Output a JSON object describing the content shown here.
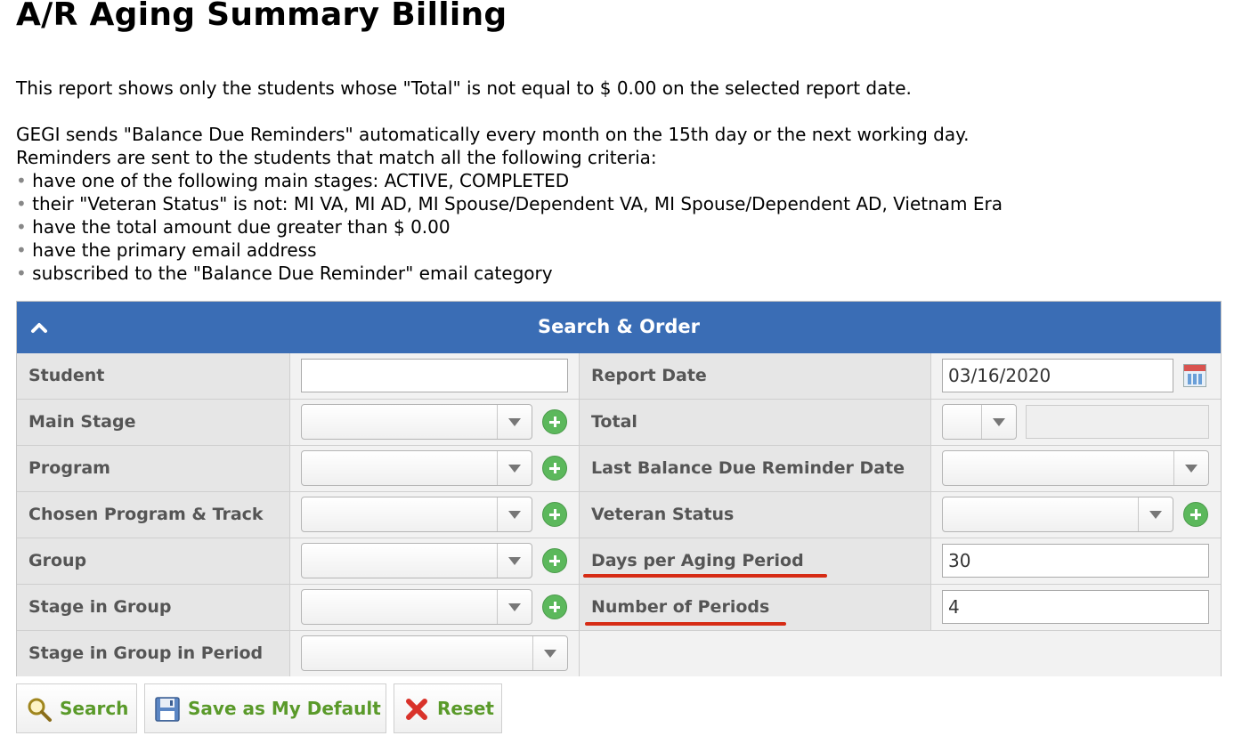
{
  "page": {
    "title": "A/R Aging Summary Billing",
    "intro": "This report shows only the students whose \"Total\" is not equal to $ 0.00 on the selected report date.",
    "reminder_line1": "GEGI sends \"Balance Due Reminders\" automatically every month on the 15th day or the next working day.",
    "reminder_line2": "Reminders are sent to the students that match all the following criteria:",
    "criteria": [
      "have one of the following main stages: ACTIVE, COMPLETED",
      "their \"Veteran Status\" is not: MI VA, MI AD, MI Spouse/Dependent VA, MI Spouse/Dependent AD, Vietnam Era",
      "have the total amount due greater than $ 0.00",
      "have the primary email address",
      "subscribed to the \"Balance Due Reminder\" email category"
    ],
    "bullet": "•"
  },
  "panel": {
    "title": "Search & Order",
    "collapse_icon": "chevron-up-icon",
    "header_color": "#3a6db5",
    "left": {
      "student": "Student",
      "main_stage": "Main Stage",
      "program": "Program",
      "chosen_program_track": "Chosen Program & Track",
      "group": "Group",
      "stage_in_group": "Stage in Group",
      "stage_in_group_in_period": "Stage in Group in Period"
    },
    "right": {
      "report_date": "Report Date",
      "report_date_value": "03/16/2020",
      "total": "Total",
      "last_reminder_date": "Last Balance Due Reminder Date",
      "veteran_status": "Veteran Status",
      "days_per_aging_period": "Days per Aging Period",
      "days_per_aging_period_value": "30",
      "number_of_periods": "Number of Periods",
      "number_of_periods_value": "4"
    }
  },
  "buttons": {
    "search": "Search",
    "save_default": "Save as My Default",
    "reset": "Reset"
  },
  "colors": {
    "annotation_underline": "#d62b14",
    "button_text": "#5a9a2a"
  }
}
